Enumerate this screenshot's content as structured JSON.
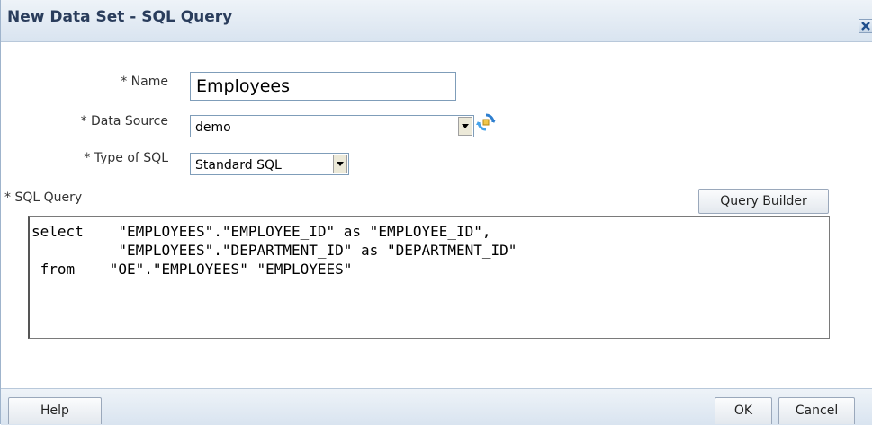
{
  "dialog": {
    "title": "New Data Set - SQL Query"
  },
  "form": {
    "name_label": "* Name",
    "name_value": "Employees",
    "data_source_label": "* Data Source",
    "data_source_value": "demo",
    "type_label": "* Type of SQL",
    "type_value": "Standard SQL",
    "sql_label": "* SQL Query",
    "query_builder_label": "Query Builder",
    "sql_text": "select    \"EMPLOYEES\".\"EMPLOYEE_ID\" as \"EMPLOYEE_ID\",\n          \"EMPLOYEES\".\"DEPARTMENT_ID\" as \"DEPARTMENT_ID\"\n from    \"OE\".\"EMPLOYEES\" \"EMPLOYEES\""
  },
  "footer": {
    "help_label": "Help",
    "ok_label": "OK",
    "cancel_label": "Cancel"
  },
  "icons": {
    "close": "close-icon",
    "refresh": "refresh-icon",
    "dropdown": "chevron-down-icon"
  },
  "colors": {
    "title_text": "#2a3d5c",
    "title_bar": "#d9e4f0",
    "refresh_icon": "#3a8fd6"
  }
}
